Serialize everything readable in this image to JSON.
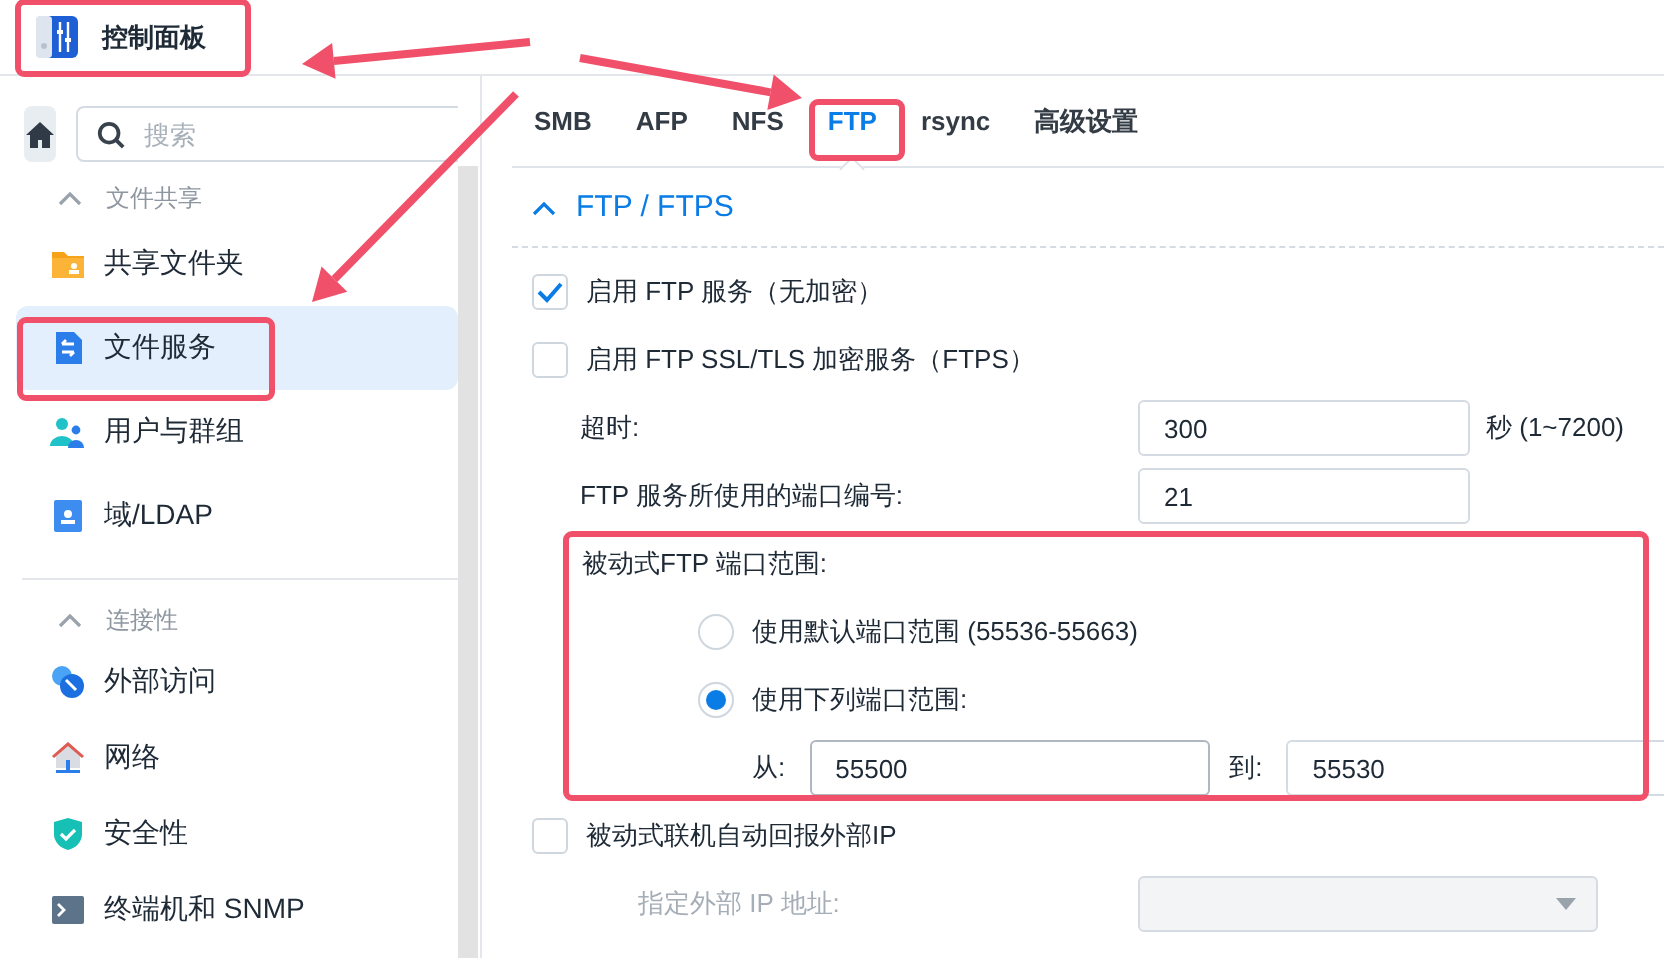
{
  "header": {
    "title": "控制面板"
  },
  "sidebar": {
    "search": {
      "placeholder": "搜索"
    },
    "groups": [
      {
        "title": "文件共享",
        "expanded": true,
        "items": [
          {
            "label": "共享文件夹",
            "selected": false
          },
          {
            "label": "文件服务",
            "selected": true
          },
          {
            "label": "用户与群组",
            "selected": false
          },
          {
            "label": "域/LDAP",
            "selected": false
          }
        ]
      },
      {
        "title": "连接性",
        "expanded": true,
        "items": [
          {
            "label": "外部访问",
            "selected": false
          },
          {
            "label": "网络",
            "selected": false
          },
          {
            "label": "安全性",
            "selected": false
          },
          {
            "label": "终端机和 SNMP",
            "selected": false
          }
        ]
      }
    ]
  },
  "tabs": [
    {
      "label": "SMB",
      "selected": false
    },
    {
      "label": "AFP",
      "selected": false
    },
    {
      "label": "NFS",
      "selected": false
    },
    {
      "label": "FTP",
      "selected": true
    },
    {
      "label": "rsync",
      "selected": false
    },
    {
      "label": "高级设置",
      "selected": false
    }
  ],
  "section": {
    "title": "FTP / FTPS",
    "expanded": true,
    "rows": [
      {
        "kind": "checkbox",
        "label": "启用 FTP 服务（无加密）",
        "checked": true
      },
      {
        "kind": "checkbox",
        "label": "启用 FTP SSL/TLS 加密服务（FTPS）",
        "checked": false
      },
      {
        "kind": "field",
        "label": "超时:",
        "value": "300",
        "suffix": "秒 (1~7200)"
      },
      {
        "kind": "field",
        "label": "FTP 服务所使用的端口编号:",
        "value": "21"
      },
      {
        "kind": "group",
        "label": "被动式FTP 端口范围:",
        "rows": [
          {
            "kind": "radio",
            "label": "使用默认端口范围 (55536-55663)",
            "selected": false
          },
          {
            "kind": "radio",
            "label": "使用下列端口范围:",
            "selected": true
          },
          {
            "kind": "range",
            "from_label": "从:",
            "from": "55500",
            "to_label": "到:",
            "to": "55530"
          }
        ]
      },
      {
        "kind": "checkbox",
        "label": "被动式联机自动回报外部IP",
        "checked": false,
        "rows": [
          {
            "kind": "select",
            "label": "指定外部 IP 地址:",
            "disabled": true
          }
        ]
      }
    ]
  }
}
